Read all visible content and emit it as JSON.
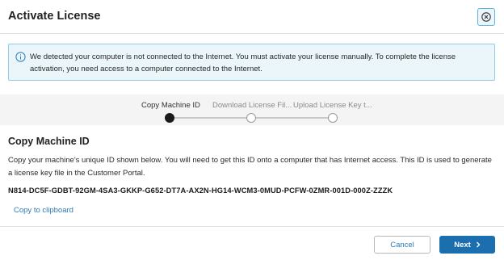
{
  "dialog": {
    "title": "Activate License"
  },
  "banner": {
    "text": "We detected your computer is not connected to the Internet. You must activate your license manually. To complete the license activation, you need access to a computer connected to the Internet."
  },
  "stepper": {
    "steps": [
      {
        "label": "Copy Machine ID",
        "state": "active"
      },
      {
        "label": "Download License Fil...",
        "state": "pending"
      },
      {
        "label": "Upload License Key t...",
        "state": "pending"
      }
    ]
  },
  "content": {
    "title": "Copy Machine ID",
    "description": "Copy your machine's unique ID shown below. You will need to get this ID onto a computer that has Internet access. This ID is used to generate a license key file in the Customer Portal.",
    "machine_id": "N814-DC5F-GDBT-92GM-4SA3-GKKP-G652-DT7A-AX2N-HG14-WCM3-0MUD-PCFW-0ZMR-001D-000Z-ZZZK",
    "copy_link": "Copy to clipboard"
  },
  "footer": {
    "cancel_label": "Cancel",
    "next_label": "Next"
  },
  "colors": {
    "accent": "#1b6fae",
    "link": "#2b7bbd",
    "banner_bg": "#eaf6fa",
    "banner_border": "#8ecde3"
  },
  "icons": {
    "close": "close-circle-icon",
    "info": "info-icon",
    "next": "chevron-right-icon"
  }
}
